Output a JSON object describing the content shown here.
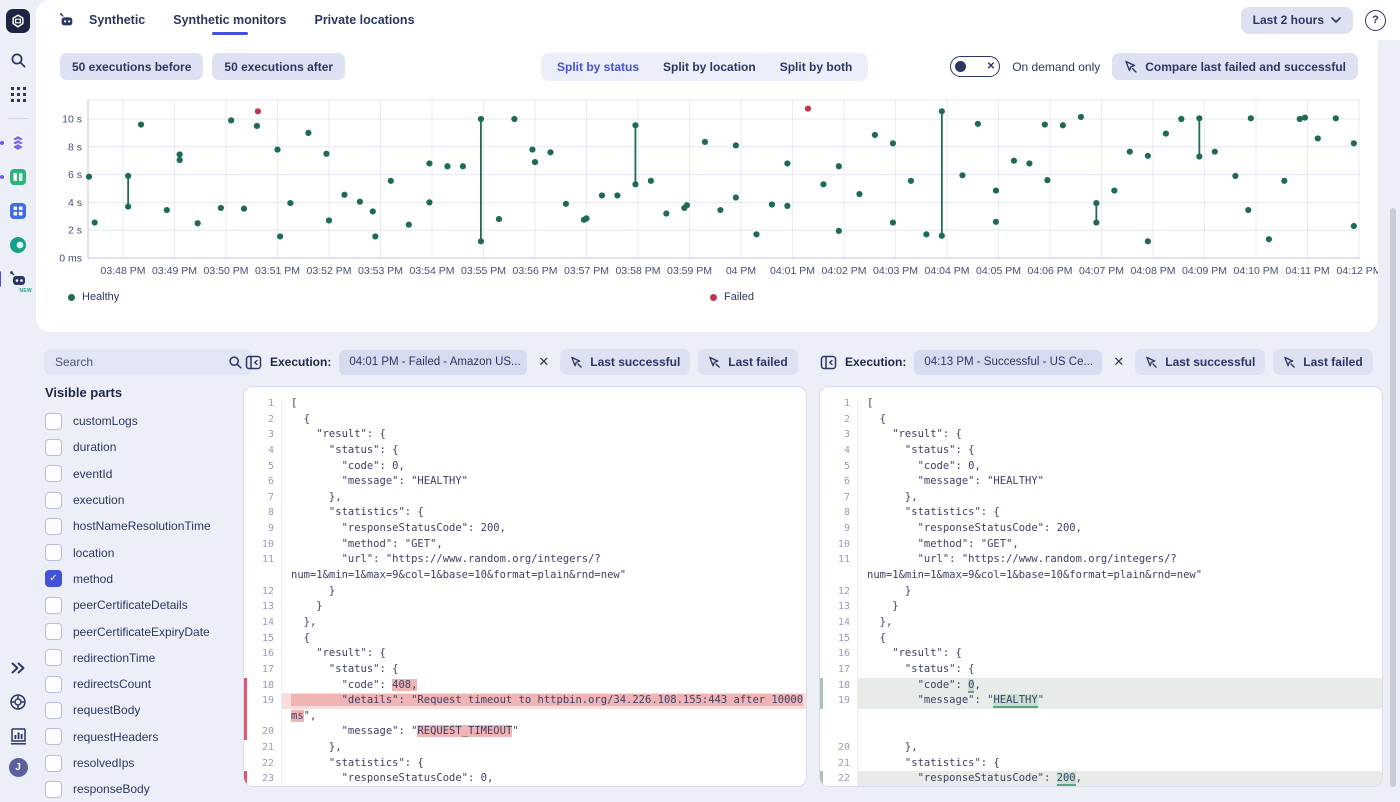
{
  "nav": {
    "tabs": [
      {
        "label": "Synthetic"
      },
      {
        "label": "Synthetic monitors",
        "active": true
      },
      {
        "label": "Private locations"
      }
    ],
    "time_range": "Last 2 hours",
    "help_glyph": "?"
  },
  "toolbar": {
    "before_label": "50 executions before",
    "after_label": "50 executions after",
    "split": [
      {
        "label": "Split by status",
        "active": true
      },
      {
        "label": "Split by location",
        "active": false
      },
      {
        "label": "Split by both",
        "active": false
      }
    ],
    "on_demand_label": "On demand only",
    "compare_label": "Compare last failed and successful"
  },
  "chart_data": {
    "type": "scatter",
    "x_tick_labels": [
      "03:48 PM",
      "03:49 PM",
      "03:50 PM",
      "03:51 PM",
      "03:52 PM",
      "03:53 PM",
      "03:54 PM",
      "03:55 PM",
      "03:56 PM",
      "03:57 PM",
      "03:58 PM",
      "03:59 PM",
      "04 PM",
      "04:01 PM",
      "04:02 PM",
      "04:03 PM",
      "04:04 PM",
      "04:05 PM",
      "04:06 PM",
      "04:07 PM",
      "04:08 PM",
      "04:09 PM",
      "04:10 PM",
      "04:11 PM",
      "04:12 PM"
    ],
    "y_tick_labels": [
      "0 ms",
      "2 s",
      "4 s",
      "6 s",
      "8 s",
      "10 s"
    ],
    "y_tick_seconds": [
      0,
      2,
      4,
      6,
      8,
      10
    ],
    "ylim_seconds": [
      0,
      11.4
    ],
    "x_unit": "minutes after 03:48 PM",
    "grid": true,
    "legend_position": "bottom",
    "series": [
      {
        "name": "Healthy",
        "color": "#1e6b53",
        "points": [
          [
            -0.7,
            5.85
          ],
          [
            -0.55,
            2.55
          ],
          [
            0.1,
            5.9
          ],
          [
            0.1,
            3.7
          ],
          [
            0.35,
            9.6
          ],
          [
            0.85,
            3.45
          ],
          [
            1.1,
            7.45
          ],
          [
            1.1,
            7.05
          ],
          [
            1.45,
            2.5
          ],
          [
            1.9,
            3.6
          ],
          [
            2.1,
            9.9
          ],
          [
            2.35,
            3.55
          ],
          [
            2.6,
            9.5
          ],
          [
            3.0,
            7.8
          ],
          [
            3.05,
            1.55
          ],
          [
            3.25,
            3.95
          ],
          [
            3.6,
            9.0
          ],
          [
            3.95,
            7.5
          ],
          [
            4.0,
            2.7
          ],
          [
            4.3,
            4.55
          ],
          [
            4.6,
            4.05
          ],
          [
            4.85,
            3.35
          ],
          [
            4.9,
            1.55
          ],
          [
            5.2,
            5.55
          ],
          [
            5.55,
            2.4
          ],
          [
            5.95,
            6.8
          ],
          [
            5.95,
            4.0
          ],
          [
            6.3,
            6.6
          ],
          [
            6.6,
            6.6
          ],
          [
            6.95,
            10.0
          ],
          [
            6.95,
            1.2
          ],
          [
            7.3,
            2.8
          ],
          [
            7.6,
            10.0
          ],
          [
            7.95,
            7.8
          ],
          [
            8.0,
            6.9
          ],
          [
            8.3,
            7.6
          ],
          [
            8.6,
            3.9
          ],
          [
            8.95,
            2.75
          ],
          [
            9.0,
            2.85
          ],
          [
            9.3,
            4.5
          ],
          [
            9.6,
            4.5
          ],
          [
            9.95,
            9.55
          ],
          [
            9.95,
            5.3
          ],
          [
            10.25,
            5.55
          ],
          [
            10.55,
            3.2
          ],
          [
            10.9,
            3.6
          ],
          [
            10.95,
            3.8
          ],
          [
            11.3,
            8.35
          ],
          [
            11.6,
            3.45
          ],
          [
            11.9,
            8.1
          ],
          [
            11.9,
            4.35
          ],
          [
            12.3,
            1.7
          ],
          [
            12.6,
            3.85
          ],
          [
            12.9,
            6.8
          ],
          [
            12.9,
            3.75
          ],
          [
            13.6,
            5.3
          ],
          [
            13.9,
            6.6
          ],
          [
            13.9,
            1.95
          ],
          [
            14.3,
            4.6
          ],
          [
            14.6,
            8.85
          ],
          [
            14.95,
            8.25
          ],
          [
            14.95,
            2.55
          ],
          [
            15.3,
            5.55
          ],
          [
            15.6,
            1.7
          ],
          [
            15.9,
            10.55
          ],
          [
            15.9,
            1.6
          ],
          [
            16.3,
            5.95
          ],
          [
            16.6,
            9.65
          ],
          [
            16.95,
            4.85
          ],
          [
            16.95,
            2.6
          ],
          [
            17.3,
            7.0
          ],
          [
            17.6,
            6.8
          ],
          [
            17.9,
            9.6
          ],
          [
            17.95,
            5.6
          ],
          [
            18.25,
            9.55
          ],
          [
            18.6,
            10.15
          ],
          [
            18.9,
            3.95
          ],
          [
            18.9,
            2.55
          ],
          [
            19.25,
            4.85
          ],
          [
            19.55,
            7.65
          ],
          [
            19.9,
            7.35
          ],
          [
            19.9,
            1.2
          ],
          [
            20.25,
            8.95
          ],
          [
            20.55,
            10.0
          ],
          [
            20.9,
            10.05
          ],
          [
            20.9,
            7.3
          ],
          [
            21.2,
            7.65
          ],
          [
            21.6,
            5.9
          ],
          [
            21.9,
            10.05
          ],
          [
            21.85,
            3.45
          ],
          [
            22.25,
            1.35
          ],
          [
            22.55,
            5.55
          ],
          [
            22.85,
            10.0
          ],
          [
            22.95,
            10.1
          ],
          [
            23.2,
            8.6
          ],
          [
            23.55,
            10.05
          ],
          [
            23.9,
            8.25
          ],
          [
            23.9,
            2.3
          ]
        ]
      },
      {
        "name": "Failed",
        "color": "#c5344e",
        "points": [
          [
            2.62,
            10.55
          ],
          [
            13.3,
            10.75
          ]
        ]
      }
    ],
    "retry_segments": [
      [
        0.1,
        3.7,
        5.9
      ],
      [
        1.1,
        7.05,
        7.45
      ],
      [
        6.95,
        1.2,
        10.0
      ],
      [
        9.95,
        5.3,
        9.55
      ],
      [
        15.9,
        1.6,
        10.55
      ],
      [
        18.9,
        2.55,
        3.95
      ],
      [
        20.9,
        7.3,
        10.05
      ]
    ]
  },
  "sidebar": {
    "search_placeholder": "Search",
    "title": "Visible parts",
    "items": [
      {
        "label": "customLogs",
        "checked": false
      },
      {
        "label": "duration",
        "checked": false
      },
      {
        "label": "eventId",
        "checked": false
      },
      {
        "label": "execution",
        "checked": false
      },
      {
        "label": "hostNameResolutionTime",
        "checked": false
      },
      {
        "label": "location",
        "checked": false
      },
      {
        "label": "method",
        "checked": true
      },
      {
        "label": "peerCertificateDetails",
        "checked": false
      },
      {
        "label": "peerCertificateExpiryDate",
        "checked": false
      },
      {
        "label": "redirectionTime",
        "checked": false
      },
      {
        "label": "redirectsCount",
        "checked": false
      },
      {
        "label": "requestBody",
        "checked": false
      },
      {
        "label": "requestHeaders",
        "checked": false
      },
      {
        "label": "resolvedIps",
        "checked": false
      },
      {
        "label": "responseBody",
        "checked": false
      }
    ]
  },
  "panels": [
    {
      "header": {
        "label": "Execution:",
        "selected": "04:01 PM - Failed - Amazon US...",
        "close_glyph": "✕",
        "last_successful": "Last successful",
        "last_failed": "Last failed"
      },
      "code": {
        "lines": [
          {
            "n": 1,
            "s": [
              [
                "[",
                ""
              ]
            ]
          },
          {
            "n": 2,
            "s": [
              [
                "  {",
                ""
              ]
            ]
          },
          {
            "n": 3,
            "s": [
              [
                "    \"result\": {",
                ""
              ]
            ]
          },
          {
            "n": 4,
            "s": [
              [
                "      \"status\": {",
                ""
              ]
            ]
          },
          {
            "n": 5,
            "s": [
              [
                "        \"code\": 0,",
                ""
              ]
            ]
          },
          {
            "n": 6,
            "s": [
              [
                "        \"message\": \"HEALTHY\"",
                ""
              ]
            ]
          },
          {
            "n": 7,
            "s": [
              [
                "      },",
                ""
              ]
            ]
          },
          {
            "n": 8,
            "s": [
              [
                "      \"statistics\": {",
                ""
              ]
            ]
          },
          {
            "n": 9,
            "s": [
              [
                "        \"responseStatusCode\": 200,",
                ""
              ]
            ]
          },
          {
            "n": 10,
            "s": [
              [
                "        \"method\": \"GET\",",
                ""
              ]
            ]
          },
          {
            "n": 11,
            "s": [
              [
                "        \"url\": \"https://www.random.org/integers/?",
                ""
              ]
            ]
          },
          {
            "s": [
              [
                "num=1&min=1&max=9&col=1&base=10&format=plain&rnd=new\"",
                ""
              ]
            ]
          },
          {
            "n": 12,
            "s": [
              [
                "      }",
                ""
              ]
            ]
          },
          {
            "n": 13,
            "s": [
              [
                "    }",
                ""
              ]
            ]
          },
          {
            "n": 14,
            "s": [
              [
                "  },",
                ""
              ]
            ]
          },
          {
            "n": 15,
            "s": [
              [
                "  {",
                ""
              ]
            ]
          },
          {
            "n": 16,
            "s": [
              [
                "    \"result\": {",
                ""
              ]
            ]
          },
          {
            "n": 17,
            "s": [
              [
                "      \"status\": {",
                ""
              ]
            ]
          },
          {
            "n": 18,
            "m": "r",
            "s": [
              [
                "        \"code\": ",
                ""
              ],
              [
                "408,",
                "r"
              ]
            ]
          },
          {
            "n": 19,
            "m": "r",
            "bg": "r",
            "s": [
              [
                "        \"details\": \"Request timeout to httpbin.org/34.226.108.155:443 after 10000",
                "r"
              ]
            ]
          },
          {
            "m": "r",
            "s": [
              [
                "ms",
                "r"
              ],
              [
                "\",",
                ""
              ]
            ]
          },
          {
            "n": 20,
            "m": "r",
            "s": [
              [
                "        \"message\": \"",
                ""
              ],
              [
                "REQUEST_TIMEOUT",
                "r"
              ],
              [
                "\"",
                ""
              ]
            ]
          },
          {
            "n": 21,
            "s": [
              [
                "      },",
                ""
              ]
            ]
          },
          {
            "n": 22,
            "s": [
              [
                "      \"statistics\": {",
                ""
              ]
            ]
          },
          {
            "n": 23,
            "m": "r",
            "s": [
              [
                "        \"responseStatusCode\": 0,",
                ""
              ]
            ]
          }
        ]
      }
    },
    {
      "header": {
        "label": "Execution:",
        "selected": "04:13 PM - Successful - US Ce...",
        "close_glyph": "✕",
        "last_successful": "Last successful",
        "last_failed": "Last failed"
      },
      "code": {
        "lines": [
          {
            "n": 1,
            "s": [
              [
                "[",
                ""
              ]
            ]
          },
          {
            "n": 2,
            "s": [
              [
                "  {",
                ""
              ]
            ]
          },
          {
            "n": 3,
            "s": [
              [
                "    \"result\": {",
                ""
              ]
            ]
          },
          {
            "n": 4,
            "s": [
              [
                "      \"status\": {",
                ""
              ]
            ]
          },
          {
            "n": 5,
            "s": [
              [
                "        \"code\": 0,",
                ""
              ]
            ]
          },
          {
            "n": 6,
            "s": [
              [
                "        \"message\": \"HEALTHY\"",
                ""
              ]
            ]
          },
          {
            "n": 7,
            "s": [
              [
                "      },",
                ""
              ]
            ]
          },
          {
            "n": 8,
            "s": [
              [
                "      \"statistics\": {",
                ""
              ]
            ]
          },
          {
            "n": 9,
            "s": [
              [
                "        \"responseStatusCode\": 200,",
                ""
              ]
            ]
          },
          {
            "n": 10,
            "s": [
              [
                "        \"method\": \"GET\",",
                ""
              ]
            ]
          },
          {
            "n": 11,
            "s": [
              [
                "        \"url\": \"https://www.random.org/integers/?",
                ""
              ]
            ]
          },
          {
            "s": [
              [
                "num=1&min=1&max=9&col=1&base=10&format=plain&rnd=new\"",
                ""
              ]
            ]
          },
          {
            "n": 12,
            "s": [
              [
                "      }",
                ""
              ]
            ]
          },
          {
            "n": 13,
            "s": [
              [
                "    }",
                ""
              ]
            ]
          },
          {
            "n": 14,
            "s": [
              [
                "  },",
                ""
              ]
            ]
          },
          {
            "n": 15,
            "s": [
              [
                "  {",
                ""
              ]
            ]
          },
          {
            "n": 16,
            "s": [
              [
                "    \"result\": {",
                ""
              ]
            ]
          },
          {
            "n": 17,
            "s": [
              [
                "      \"status\": {",
                ""
              ]
            ]
          },
          {
            "n": 18,
            "m": "g",
            "bg": "g",
            "s": [
              [
                "        \"code\": ",
                ""
              ],
              [
                "0",
                "g"
              ],
              [
                ",",
                ""
              ]
            ]
          },
          {
            "n": 19,
            "m": "g",
            "bg": "g",
            "s": [
              [
                "        \"message\": \"",
                ""
              ],
              [
                "HEALTHY",
                "g"
              ],
              [
                "\"",
                ""
              ]
            ]
          },
          {
            "s": []
          },
          {
            "s": []
          },
          {
            "n": 20,
            "s": [
              [
                "      },",
                ""
              ]
            ]
          },
          {
            "n": 21,
            "s": [
              [
                "      \"statistics\": {",
                ""
              ]
            ]
          },
          {
            "n": 22,
            "m": "g",
            "bg": "g",
            "s": [
              [
                "        \"responseStatusCode\": ",
                ""
              ],
              [
                "200",
                "g"
              ],
              [
                ",",
                ""
              ]
            ]
          }
        ]
      }
    }
  ],
  "rail": {
    "avatar_initial": "J",
    "new_badge": "NEW"
  },
  "colors": {
    "accent": "#4353d9",
    "healthy": "#1e6b53",
    "failed": "#c5344e"
  }
}
